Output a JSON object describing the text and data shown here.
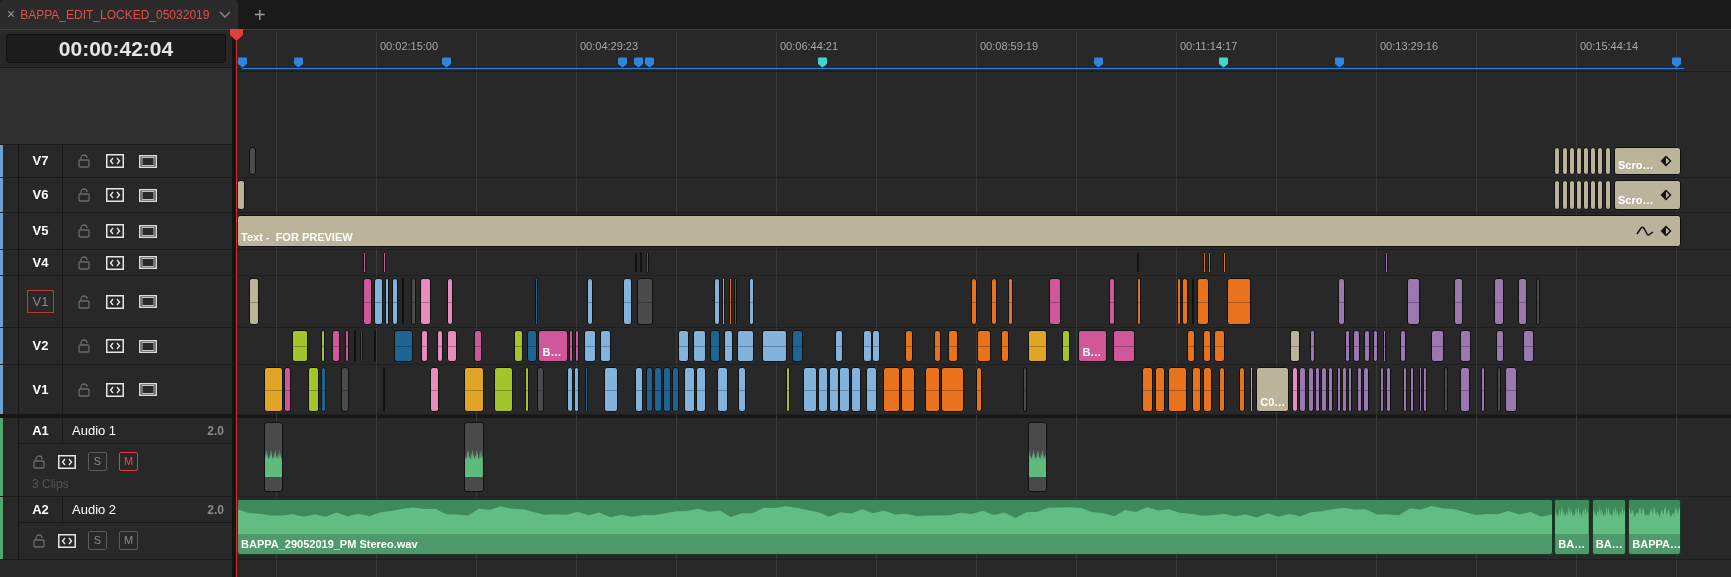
{
  "tab": {
    "title": "BAPPA_EDIT_LOCKED_05032019",
    "close": "×",
    "add": "+"
  },
  "timecode": "00:00:42:04",
  "ruler": [
    "00:02:15:00",
    "00:04:29:23",
    "00:06:44:21",
    "00:08:59:19",
    "00:11:14:17",
    "00:13:29:16",
    "00:15:44:14"
  ],
  "video_tracks": [
    {
      "name": "V7",
      "kind": "track",
      "clips": [
        {
          "label": "Scro…",
          "color": "#bcb39b"
        }
      ]
    },
    {
      "name": "V6",
      "kind": "track",
      "clips": [
        {
          "label": "Scro…",
          "color": "#bcb39b"
        }
      ]
    },
    {
      "name": "V5",
      "kind": "track",
      "clips": [
        {
          "label": "Text -  FOR PREVIEW",
          "color": "#bcb39b"
        }
      ]
    },
    {
      "name": "V4",
      "kind": "track"
    },
    {
      "name": "V1",
      "kind": "destination"
    },
    {
      "name": "V2",
      "kind": "track",
      "clips": [
        {
          "label": "B…",
          "color": "#d0579a"
        },
        {
          "label": "B…",
          "color": "#d0579a"
        }
      ]
    },
    {
      "name": "V1",
      "kind": "track",
      "clips": [
        {
          "label": "C0…",
          "color": "#bcb39b"
        }
      ]
    }
  ],
  "audio_tracks": [
    {
      "id": "A1",
      "name": "Audio 1",
      "format": "2.0",
      "solo": "S",
      "mute": "M",
      "solo_on": false,
      "mute_on": true,
      "info": "3 Clips"
    },
    {
      "id": "A2",
      "name": "Audio 2",
      "format": "2.0",
      "solo": "S",
      "mute": "M",
      "solo_on": false,
      "mute_on": false,
      "clips": [
        {
          "label": "BAPPA_29052019_PM Stereo.wav"
        },
        {
          "label": "BA…"
        },
        {
          "label": "BA…"
        },
        {
          "label": "BAPPA…"
        }
      ]
    }
  ]
}
